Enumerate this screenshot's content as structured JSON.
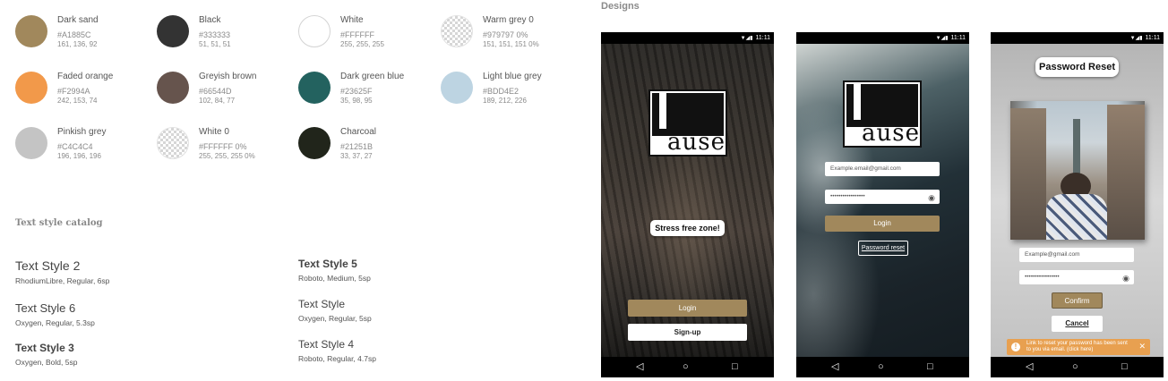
{
  "colors": [
    {
      "name": "Dark sand",
      "hex": "#A1885C",
      "rgb": "161, 136, 92",
      "fill": "#A1885C",
      "style": "solid"
    },
    {
      "name": "Black",
      "hex": "#333333",
      "rgb": "51, 51, 51",
      "fill": "#333333",
      "style": "solid"
    },
    {
      "name": "White",
      "hex": "#FFFFFF",
      "rgb": "255, 255, 255",
      "fill": "#FFFFFF",
      "style": "outline"
    },
    {
      "name": "Warm grey 0",
      "hex": "#979797 0%",
      "rgb": "151, 151, 151 0%",
      "fill": "#979797",
      "style": "checker"
    },
    {
      "name": "Faded orange",
      "hex": "#F2994A",
      "rgb": "242, 153, 74",
      "fill": "#F2994A",
      "style": "solid"
    },
    {
      "name": "Greyish brown",
      "hex": "#66544D",
      "rgb": "102, 84, 77",
      "fill": "#66544D",
      "style": "solid"
    },
    {
      "name": "Dark green blue",
      "hex": "#23625F",
      "rgb": "35, 98, 95",
      "fill": "#23625F",
      "style": "solid"
    },
    {
      "name": "Light blue grey",
      "hex": "#BDD4E2",
      "rgb": "189, 212, 226",
      "fill": "#BDD4E2",
      "style": "solid"
    },
    {
      "name": "Pinkish grey",
      "hex": "#C4C4C4",
      "rgb": "196, 196, 196",
      "fill": "#C4C4C4",
      "style": "solid"
    },
    {
      "name": "White 0",
      "hex": "#FFFFFF 0%",
      "rgb": "255, 255, 255 0%",
      "fill": "#FFFFFF",
      "style": "checker"
    },
    {
      "name": "Charcoal",
      "hex": "#21251B",
      "rgb": "33, 37, 27",
      "fill": "#21251B",
      "style": "solid"
    }
  ],
  "text_catalog": {
    "title": "Text style catalog",
    "styles": [
      {
        "name": "Text Style 2",
        "meta": "RhodiumLibre, Regular, 6sp"
      },
      {
        "name": "Text Style 6",
        "meta": "Oxygen, Regular, 5.3sp"
      },
      {
        "name": "Text Style 3",
        "meta": "Oxygen, Bold, 5sp"
      },
      {
        "name": "Text Style 5",
        "meta": "Roboto, Medium, 5sp"
      },
      {
        "name": "Text Style",
        "meta": "Oxygen, Regular, 5sp"
      },
      {
        "name": "Text Style 4",
        "meta": "Roboto, Regular, 4.7sp"
      }
    ]
  },
  "designs": {
    "title": "Designs",
    "status_time": "11:11",
    "nav": {
      "back": "◁",
      "home": "○",
      "recent": "□"
    },
    "logo_text": "ause",
    "welcome": {
      "tagline": "Stress free zone!",
      "login_label": "Login",
      "signup_label": "Sign-up"
    },
    "login": {
      "email_value": "Example.email@gmail.com",
      "password_value": "•••••••••••••••••",
      "login_label": "Login",
      "reset_label": "Password reset"
    },
    "reset": {
      "title": "Password Reset",
      "email_value": "Example@gmail.com",
      "password_value": "•••••••••••••••••",
      "confirm_label": "Confirm",
      "cancel_label": "Cancel",
      "toast_message": "Link to reset your password has been sent to you via email. (click here)",
      "toast_close": "✕",
      "toast_icon": "!"
    }
  }
}
